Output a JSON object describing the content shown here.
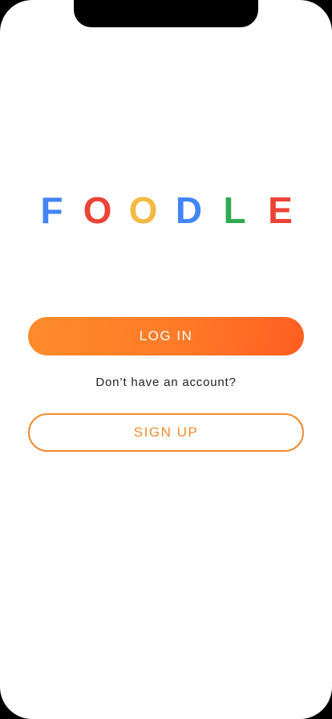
{
  "logo": {
    "letters": [
      {
        "char": "F",
        "color": "#4285f4"
      },
      {
        "char": "O",
        "color": "#ea4335"
      },
      {
        "char": "O",
        "color": "#f4b942"
      },
      {
        "char": "D",
        "color": "#4285f4"
      },
      {
        "char": "L",
        "color": "#34a853"
      },
      {
        "char": "E",
        "color": "#ea4335"
      }
    ]
  },
  "auth": {
    "login_label": "LOG IN",
    "prompt_text": "Don’t have an account?",
    "signup_label": "SIGN UP"
  },
  "colors": {
    "accent": "#f28a2e",
    "gradient_start": "#ff8c2a",
    "gradient_end": "#ff5e22"
  }
}
